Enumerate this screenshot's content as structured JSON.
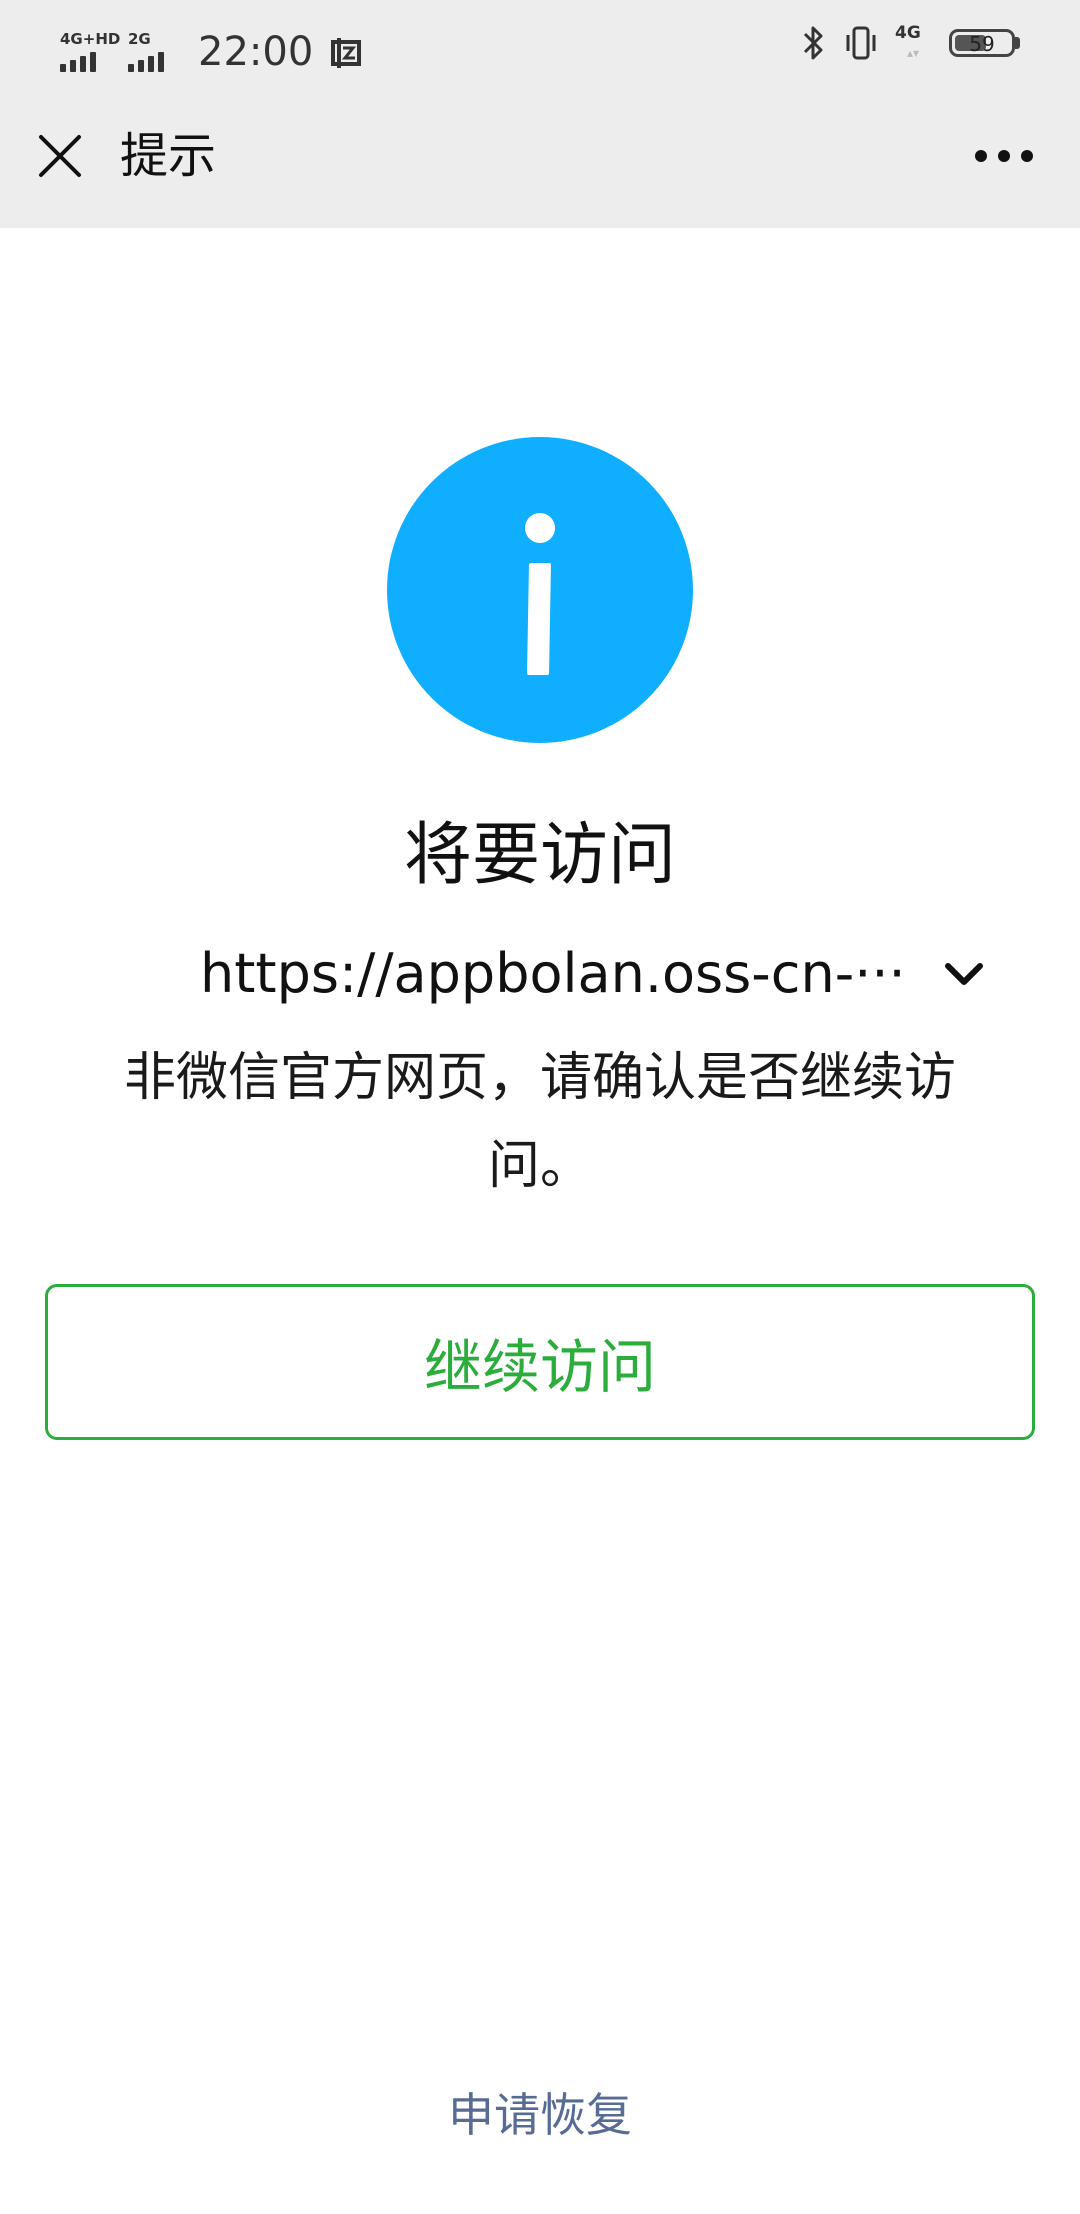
{
  "status_bar": {
    "network1_label": "4G+HD",
    "network2_label": "2G",
    "time": "22:00",
    "network3_label": "4G",
    "network3_arrows": "▴▾",
    "battery_level": "59",
    "icons": [
      "signal-icon",
      "signal-icon",
      "screenshot-notification-icon",
      "bluetooth-icon",
      "vibrate-icon",
      "battery-icon"
    ]
  },
  "nav": {
    "title": "提示",
    "close_icon": "close-icon",
    "more_icon": "more-icon"
  },
  "main": {
    "icon": "info-icon",
    "icon_color": "#10aeff",
    "heading": "将要访问",
    "url": "https://appbolan.oss-cn-···",
    "description": "非微信官方网页，请确认是否继续访问。",
    "continue_label": "继续访问",
    "continue_color": "#2aad3b",
    "appeal_label": "申请恢复",
    "appeal_color": "#576b95"
  }
}
